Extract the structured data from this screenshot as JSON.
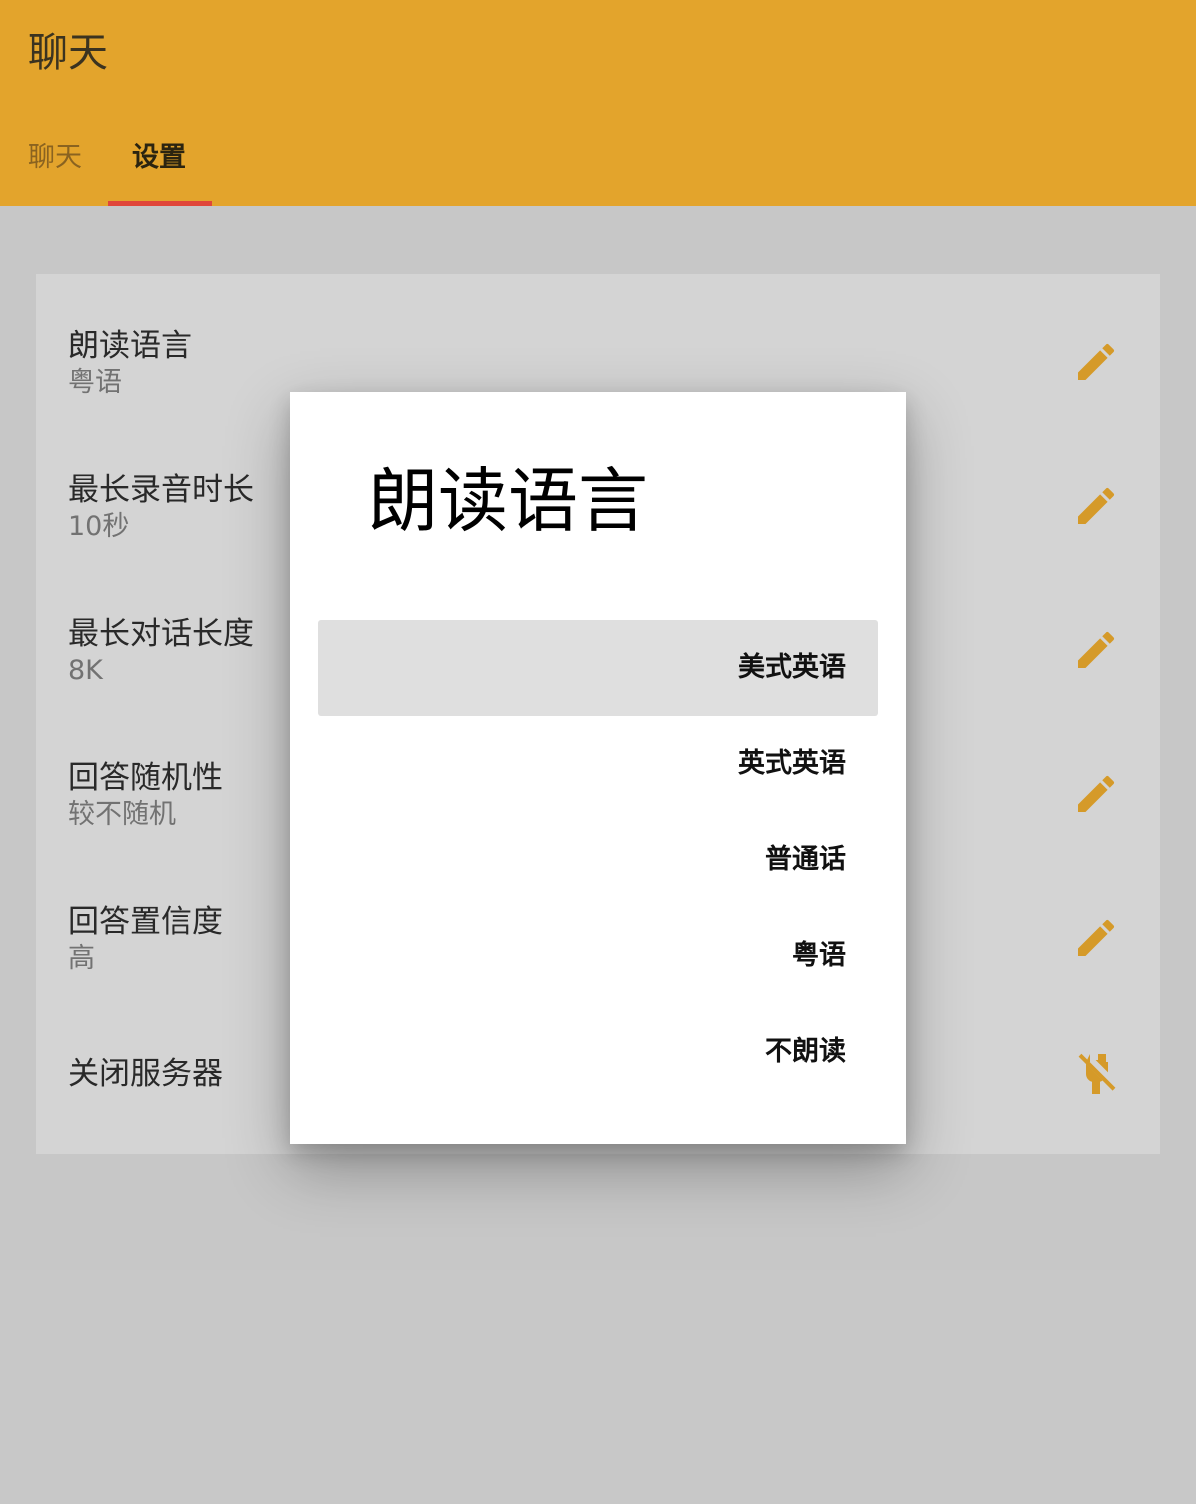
{
  "app": {
    "title": "聊天",
    "accent_color": "#e3a42c",
    "tab_indicator_color": "#e0463a"
  },
  "tabs": [
    {
      "label": "聊天",
      "active": false
    },
    {
      "label": "设置",
      "active": true
    }
  ],
  "settings": [
    {
      "label": "朗读语言",
      "value": "粤语",
      "icon": "pencil-icon"
    },
    {
      "label": "最长录音时长",
      "value": "10秒",
      "icon": "pencil-icon"
    },
    {
      "label": "最长对话长度",
      "value": "8K",
      "icon": "pencil-icon"
    },
    {
      "label": "回答随机性",
      "value": "较不随机",
      "icon": "pencil-icon"
    },
    {
      "label": "回答置信度",
      "value": "高",
      "icon": "pencil-icon"
    },
    {
      "label": "关闭服务器",
      "value": "",
      "icon": "power-off-icon"
    }
  ],
  "dialog": {
    "title": "朗读语言",
    "options": [
      {
        "label": "美式英语",
        "highlighted": true
      },
      {
        "label": "英式英语",
        "highlighted": false
      },
      {
        "label": "普通话",
        "highlighted": false
      },
      {
        "label": "粤语",
        "highlighted": false
      },
      {
        "label": "不朗读",
        "highlighted": false
      }
    ]
  }
}
